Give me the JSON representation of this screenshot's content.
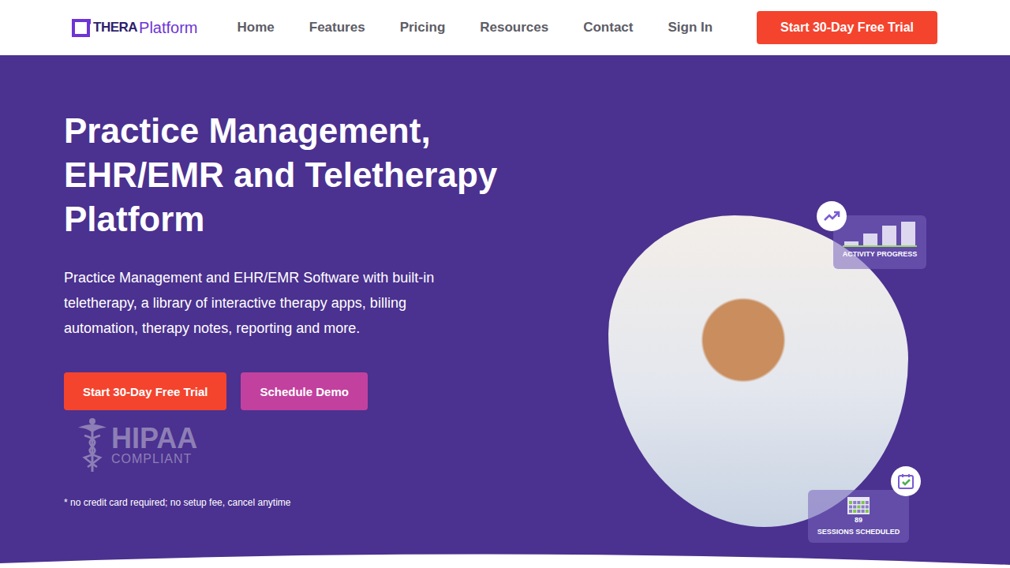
{
  "header": {
    "logo": {
      "part1": "THERA",
      "part2": "Platform"
    },
    "nav": [
      {
        "label": "Home",
        "selected": false
      },
      {
        "label": "Features",
        "selected": false
      },
      {
        "label": "Pricing",
        "selected": false
      },
      {
        "label": "Resources",
        "selected": false
      },
      {
        "label": "Contact",
        "selected": false
      },
      {
        "label": "Sign In",
        "selected": false
      }
    ],
    "cta": "Start 30-Day Free Trial"
  },
  "hero": {
    "title": "Practice Management, EHR/EMR and Teletherapy Platform",
    "description": "Practice Management and EHR/EMR Software with built-in teletherapy, a library of interactive therapy apps, billing automation, therapy notes, reporting and more.",
    "buttons": [
      {
        "label": "Start 30-Day Free Trial",
        "kind": "primary"
      },
      {
        "label": "Schedule Demo",
        "kind": "secondary"
      }
    ],
    "badge": {
      "title": "HIPAA",
      "subtitle": "COMPLIANT"
    },
    "note": "* no credit card required; no setup fee, cancel anytime"
  },
  "cards": {
    "activity": {
      "label": "ACTIVITY PROGRESS",
      "values": [
        1,
        3,
        5,
        6
      ]
    },
    "sessions": {
      "count": "89",
      "label": "SESSIONS SCHEDULED"
    }
  }
}
